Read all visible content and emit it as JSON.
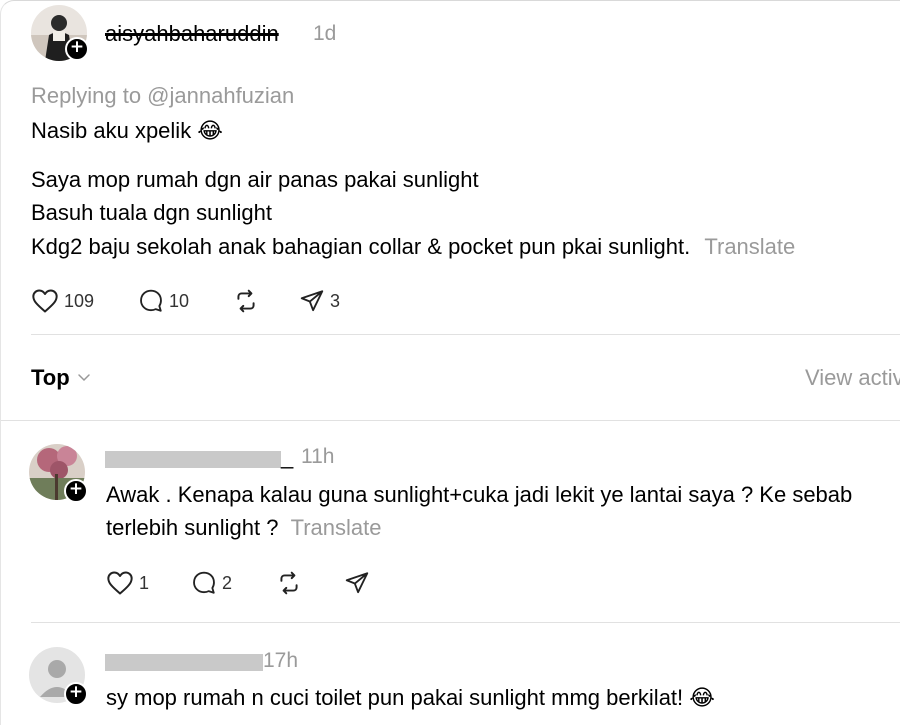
{
  "post": {
    "username": "aisyahbaharuddin",
    "time": "1d",
    "replying_to": "Replying to @jannahfuzian",
    "line1": "Nasib aku xpelik 😂",
    "line2": "Saya mop rumah dgn air panas pakai sunlight",
    "line3": "Basuh tuala dgn sunlight",
    "line4": "Kdg2 baju sekolah anak bahagian collar & pocket pun pkai sunlight.",
    "translate": "Translate",
    "likes": "109",
    "replies": "10",
    "shares": "3"
  },
  "sort": {
    "label": "Top",
    "view_activity": "View activ"
  },
  "replies": [
    {
      "username_visible": "_",
      "time": "11h",
      "line1": "Awak . Kenapa kalau guna sunlight+cuka jadi lekit ye lantai saya ? Ke sebab",
      "line2": "terlebih sunlight ?",
      "translate": "Translate",
      "likes": "1",
      "replies": "2"
    },
    {
      "time": "17h",
      "line1": "sy mop rumah n cuci toilet pun pakai sunlight mmg berkilat! 😂"
    }
  ],
  "colors": {
    "muted_text": "#9a9a9a",
    "divider": "#e1e1e1",
    "redaction": "#c9c9c9"
  }
}
